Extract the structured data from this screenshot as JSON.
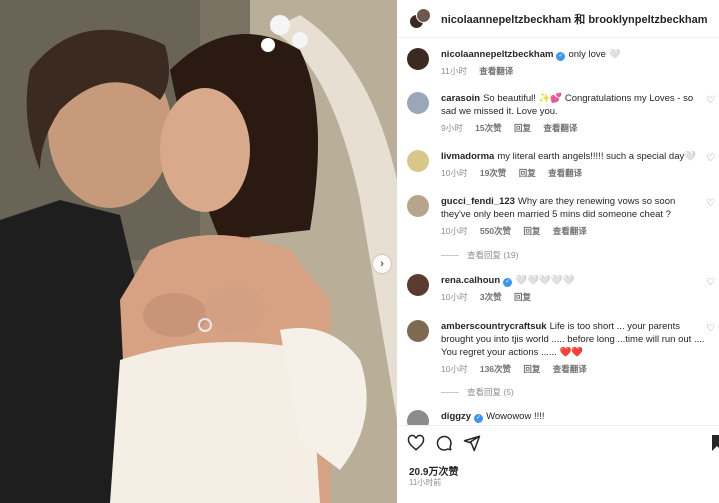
{
  "post": {
    "header_users": "nicolaannepeltzbeckham 和 brooklynpeltzbeckham",
    "likes": "20.9万次赞",
    "time": "11小时前"
  },
  "caption": {
    "username": "nicolaannepeltzbeckham",
    "text": "only love 🤍",
    "time": "11小时",
    "translate": "查看翻译"
  },
  "comments": [
    {
      "username": "carasoin",
      "verified": false,
      "text": "So beautiful! ✨💕 Congratulations my Loves - so sad we missed it. Love you.",
      "time": "9小时",
      "likes": "15次赞",
      "reply": "回复",
      "translate": "查看翻译",
      "avatar_color": "#9aa7b8"
    },
    {
      "username": "livmadorma",
      "verified": false,
      "text": "my literal earth angels!!!!! such a special day🤍",
      "time": "10小时",
      "likes": "19次赞",
      "reply": "回复",
      "translate": "查看翻译",
      "avatar_color": "#d9c78a"
    },
    {
      "username": "gucci_fendi_123",
      "verified": false,
      "text": "Why are they renewing vows so soon they've only been married 5 mins did someone cheat ?",
      "time": "10小时",
      "likes": "550次赞",
      "reply": "回复",
      "translate": "查看翻译",
      "view_replies": "查看回复 (19)",
      "avatar_color": "#b6a58a"
    },
    {
      "username": "rena.calhoun",
      "verified": true,
      "text": "🤍🤍🤍🤍🤍",
      "time": "10小时",
      "likes": "3次赞",
      "reply": "回复",
      "avatar_color": "#5a3b2e"
    },
    {
      "username": "amberscountrycraftsuk",
      "verified": false,
      "text": "Life is too short ... your parents brought you into tjis world ..... before long ...time will run out .... You regret your actions ...... ❤️❤️",
      "time": "10小时",
      "likes": "136次赞",
      "reply": "回复",
      "translate": "查看翻译",
      "view_replies": "查看回复 (5)",
      "avatar_color": "#7e6a50"
    },
    {
      "username": "diggzy",
      "verified": true,
      "text": "Wowowow !!!!",
      "avatar_color": "#8c8c8c"
    }
  ],
  "icons": {
    "like": "heart-icon",
    "comment": "comment-icon",
    "share": "share-icon",
    "save": "bookmark-icon"
  },
  "colors": {
    "verified": "#3897f0",
    "meta_text": "#8e8e8e"
  }
}
